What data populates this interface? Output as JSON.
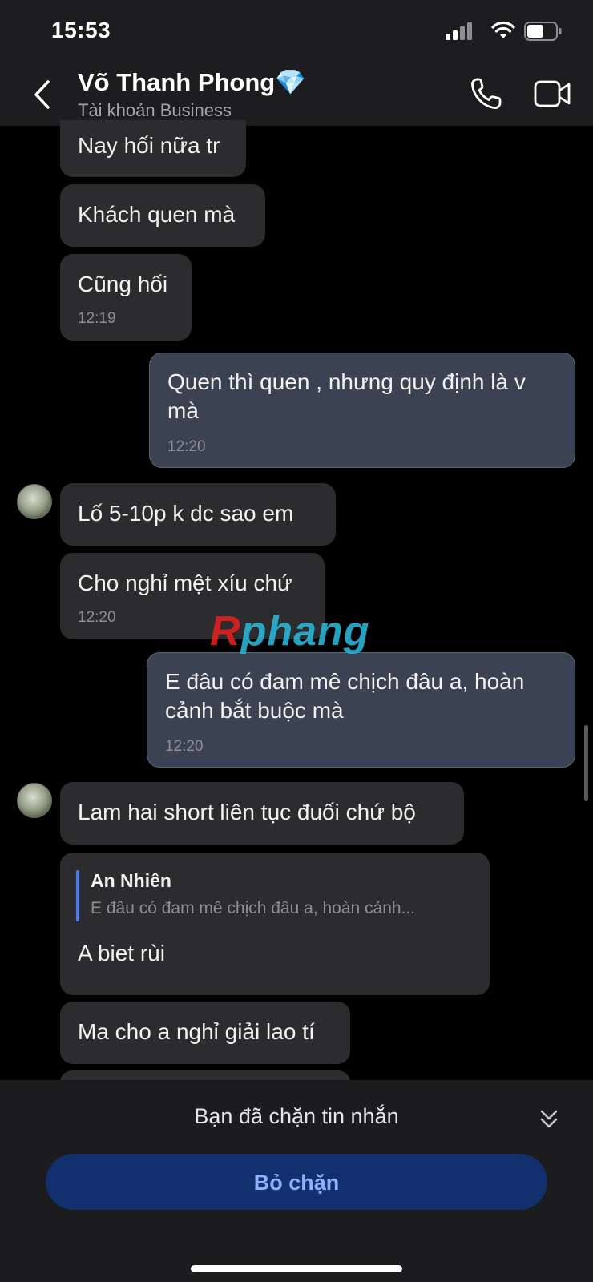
{
  "status_bar": {
    "time": "15:53",
    "signal_icon": "signal-icon",
    "wifi_icon": "wifi-icon",
    "battery_icon": "battery-icon"
  },
  "header": {
    "name": "Võ Thanh Phong💎",
    "subtitle": "Tài khoản Business",
    "back_icon": "chevron-left-icon",
    "call_icon": "phone-icon",
    "video_icon": "video-camera-icon"
  },
  "messages": [
    {
      "dir": "in",
      "text": "Nay hối nữa tr"
    },
    {
      "dir": "in",
      "text": "Khách quen mà"
    },
    {
      "dir": "in",
      "text": "Cũng hối",
      "time": "12:19"
    },
    {
      "dir": "out",
      "text": "Quen thì quen , nhưng quy định là v mà",
      "time": "12:20"
    },
    {
      "dir": "in",
      "text": "Lố 5-10p k dc sao em"
    },
    {
      "dir": "in",
      "text": "Cho nghỉ mệt xíu chứ",
      "time": "12:20"
    },
    {
      "dir": "out",
      "text": "E đâu có đam mê chịch đâu a, hoàn cảnh bắt buộc mà",
      "time": "12:20"
    },
    {
      "dir": "in",
      "text": "Lam hai short liên tục đuối chứ bộ"
    },
    {
      "dir": "in",
      "quote_name": "An Nhiên",
      "quote_text": "E đâu có đam mê chịch đâu a, hoàn cảnh...",
      "text": "A biet rùi"
    },
    {
      "dir": "in",
      "text": "Ma cho a nghỉ giải lao tí"
    }
  ],
  "watermark": {
    "first": "R",
    "rest": "phang"
  },
  "footer": {
    "blocked_text": "Bạn đã chặn tin nhắn",
    "unblock_label": "Bỏ chặn",
    "scroll_down_icon": "double-chevron-down-icon"
  },
  "colors": {
    "accent": "#12306e",
    "accent_text": "#8fb0ff",
    "outgoing_bubble": "#3b4252",
    "incoming_bubble": "#2c2c2e"
  }
}
